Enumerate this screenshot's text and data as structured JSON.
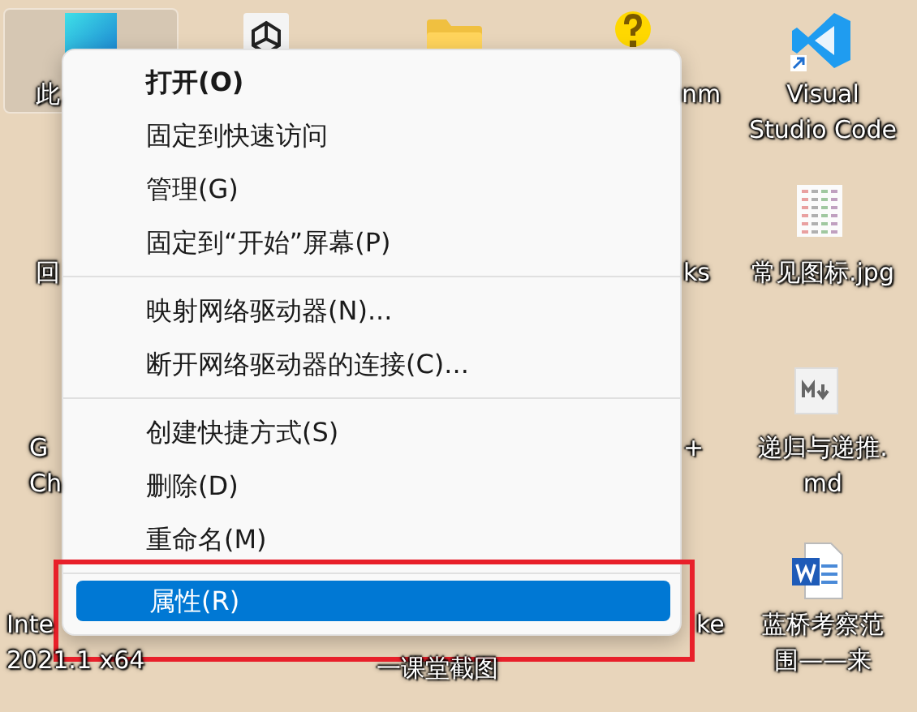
{
  "desktop_icons": [
    {
      "kind": "monitor",
      "lines": [
        "此"
      ],
      "selected": true
    },
    {
      "kind": "unity"
    },
    {
      "kind": "folder"
    },
    {
      "kind": "help",
      "lines": [
        "nm"
      ]
    },
    {
      "kind": "vscode",
      "lines": [
        "Visual",
        "Studio Code"
      ]
    },
    {
      "kind": "none",
      "lines": [
        "回"
      ]
    },
    {
      "kind": "none",
      "lines": [
        "ks"
      ]
    },
    {
      "kind": "image",
      "lines": [
        "常见图标.jpg"
      ]
    },
    {
      "kind": "none",
      "lines": [
        "G",
        "Ch"
      ]
    },
    {
      "kind": "none",
      "lines": [
        "+"
      ]
    },
    {
      "kind": "markdown",
      "lines": [
        "递归与递推.",
        "md"
      ]
    },
    {
      "kind": "none",
      "lines": [
        "Inte",
        "2021.1 x64"
      ]
    },
    {
      "kind": "none",
      "lines": [
        "ke"
      ]
    },
    {
      "kind": "none",
      "lines": [
        "一课堂截图"
      ]
    },
    {
      "kind": "word",
      "lines": [
        "蓝桥考察范",
        "围——来"
      ]
    }
  ],
  "context_menu": {
    "groups": [
      [
        {
          "label": "打开(O)",
          "bold": true,
          "selected": false
        },
        {
          "label": "固定到快速访问",
          "bold": false,
          "selected": false
        },
        {
          "label": "管理(G)",
          "bold": false,
          "selected": false
        },
        {
          "label": "固定到“开始”屏幕(P)",
          "bold": false,
          "selected": false
        }
      ],
      [
        {
          "label": "映射网络驱动器(N)...",
          "bold": false,
          "selected": false
        },
        {
          "label": "断开网络驱动器的连接(C)...",
          "bold": false,
          "selected": false
        }
      ],
      [
        {
          "label": "创建快捷方式(S)",
          "bold": false,
          "selected": false
        },
        {
          "label": "删除(D)",
          "bold": false,
          "selected": false
        },
        {
          "label": "重命名(M)",
          "bold": false,
          "selected": false
        }
      ],
      [
        {
          "label": "属性(R)",
          "bold": false,
          "selected": true
        }
      ]
    ]
  }
}
